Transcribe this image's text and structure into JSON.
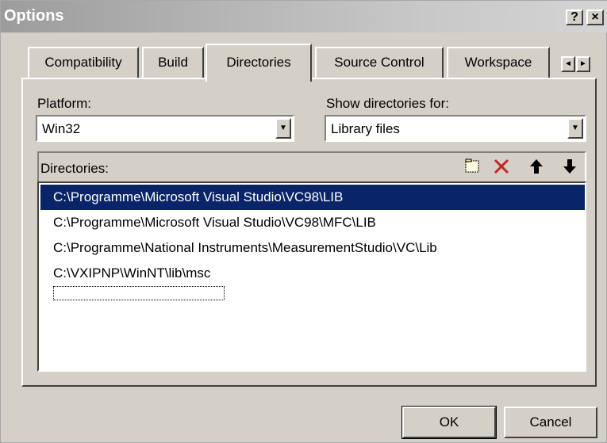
{
  "window": {
    "title": "Options",
    "help_label": "?",
    "close_label": "×"
  },
  "tabs": [
    {
      "label": "Compatibility",
      "active": false
    },
    {
      "label": "Build",
      "active": false
    },
    {
      "label": "Directories",
      "active": true
    },
    {
      "label": "Source Control",
      "active": false
    },
    {
      "label": "Workspace",
      "active": false
    }
  ],
  "tab_scroll": {
    "left": "◄",
    "right": "►"
  },
  "platform": {
    "label": "Platform:",
    "value": "Win32"
  },
  "show_dirs": {
    "label": "Show directories for:",
    "value": "Library files"
  },
  "directories": {
    "label": "Directories:",
    "items": [
      "C:\\Programme\\Microsoft Visual Studio\\VC98\\LIB",
      "C:\\Programme\\Microsoft Visual Studio\\VC98\\MFC\\LIB",
      "C:\\Programme\\National Instruments\\MeasurementStudio\\VC\\Lib",
      "C:\\VXIPNP\\WinNT\\lib\\msc"
    ],
    "selected_index": 0
  },
  "toolbar_icons": [
    "new-folder-icon",
    "delete-icon",
    "move-up-icon",
    "move-down-icon"
  ],
  "buttons": {
    "ok": "OK",
    "cancel": "Cancel"
  },
  "colors": {
    "selection": "#0a246a",
    "delete": "#c0282c",
    "face": "#d4d0c8"
  }
}
